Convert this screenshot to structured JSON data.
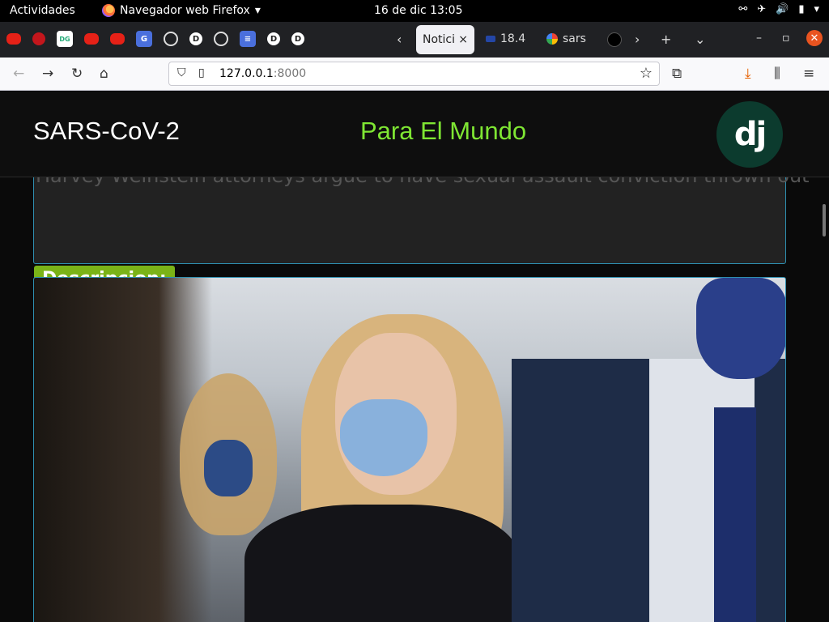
{
  "topbar": {
    "activities": "Actividades",
    "app_name": "Navegador web Firefox",
    "clock": "16 de dic  13:05"
  },
  "tabs": {
    "active": {
      "label": "Notici",
      "close": "×"
    },
    "others": [
      {
        "label": "18.4"
      },
      {
        "label": "sars"
      }
    ]
  },
  "navbar": {
    "url_host": "127.0.0.1",
    "url_port": ":8000"
  },
  "site": {
    "brand": "SARS-CoV-2",
    "slogan": "Para El Mundo",
    "logo_text": "dj"
  },
  "article": {
    "headline": "Harvey Weinstein attorneys argue to have sexual assault conviction thrown out",
    "description_label": "Descripcion:"
  },
  "colors": {
    "slogan": "#7fe633",
    "badge": "#7ab317",
    "card_border": "#2e8fb0"
  }
}
